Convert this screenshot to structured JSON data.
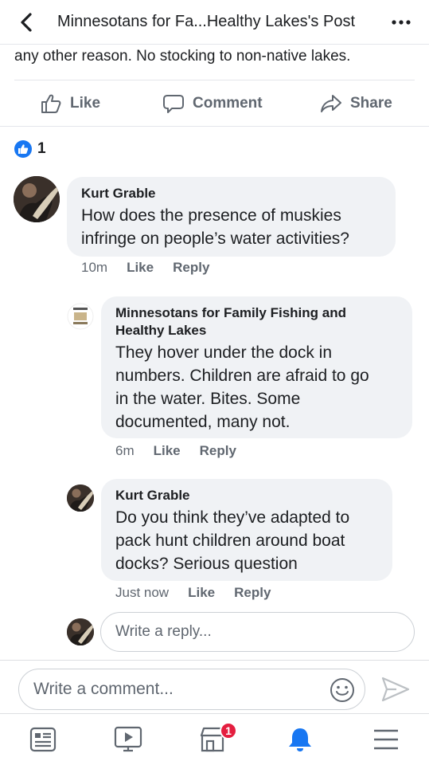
{
  "header": {
    "title": "Minnesotans for Fa...Healthy Lakes's Post"
  },
  "post": {
    "text_tail": "any other reason. No stocking to non-native lakes."
  },
  "actions": {
    "like": "Like",
    "comment": "Comment",
    "share": "Share"
  },
  "reactions": {
    "count": "1"
  },
  "comments": [
    {
      "author": "Kurt Grable",
      "lines": [
        "How does the presence of muskies",
        "infringe on people’s water activities?"
      ],
      "time": "10m",
      "like": "Like",
      "reply": "Reply"
    },
    {
      "author_lines": [
        "Minnesotans for Family Fishing and",
        "Healthy Lakes"
      ],
      "lines": [
        "They hover under the dock in",
        "numbers. Children are afraid to go",
        "in the water.  Bites. Some",
        "documented, many not."
      ],
      "time": "6m",
      "like": "Like",
      "reply": "Reply",
      "avatar_text": "FAMILY FISHING"
    },
    {
      "author": "Kurt Grable",
      "lines": [
        "Do you think they’ve adapted to",
        "pack hunt children around boat",
        "docks? Serious question"
      ],
      "time": "Just now",
      "like": "Like",
      "reply": "Reply"
    }
  ],
  "reply_input": {
    "placeholder": "Write a reply..."
  },
  "comment_input": {
    "placeholder": "Write a comment..."
  },
  "tabbar": {
    "marketplace_badge": "1",
    "active_color": "#1877f2"
  }
}
